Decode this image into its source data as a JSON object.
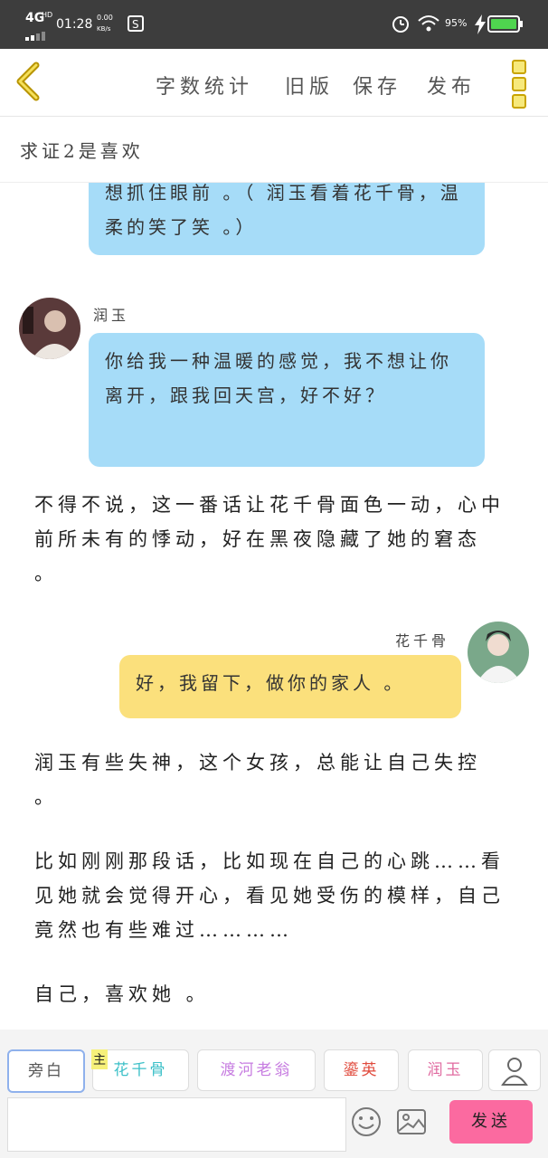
{
  "status_bar": {
    "network": "4G",
    "hd": "HD",
    "time": "01:28",
    "speed": "0.00",
    "speed_unit": "KB/s",
    "battery": "95%"
  },
  "toolbar": {
    "word_count": "字数统计",
    "old_version": "旧版",
    "save": "保存",
    "publish": "发布"
  },
  "story": {
    "title": "求证2是喜欢"
  },
  "messages": {
    "m1": {
      "text": "想抓住眼前 。（ 润玉看着花千骨，温柔的笑了笑 。）"
    },
    "m2": {
      "speaker": "润玉",
      "text": "你给我一种温暖的感觉，我不想让你离开，跟我回天宫，好不好？"
    },
    "n1": {
      "text": "不得不说，这一番话让花千骨面色一动，心中前所未有的悸动，好在黑夜隐藏了她的窘态 。"
    },
    "m3": {
      "speaker": "花千骨",
      "text": "好，我留下，做你的家人 。"
    },
    "n2": {
      "text": " 润玉有些失神，这个女孩，总能让自己失控 。"
    },
    "n3": {
      "text": "比如刚刚那段话，比如现在自己的心跳……看见她就会觉得开心，看见她受伤的模样，自己竟然也有些难过…………"
    },
    "n4": {
      "text": "自己，喜欢她 。"
    }
  },
  "roles": [
    {
      "label": "旁白",
      "color": "#555555"
    },
    {
      "label": "花千骨",
      "color": "#3cc0c8"
    },
    {
      "label": "渡河老翁",
      "color": "#c67be0"
    },
    {
      "label": "鎏英",
      "color": "#e04a3c"
    },
    {
      "label": "润玉",
      "color": "#e06aa0"
    }
  ],
  "main_badge": "主",
  "input": {
    "value": "",
    "placeholder": ""
  },
  "send_label": "发送"
}
